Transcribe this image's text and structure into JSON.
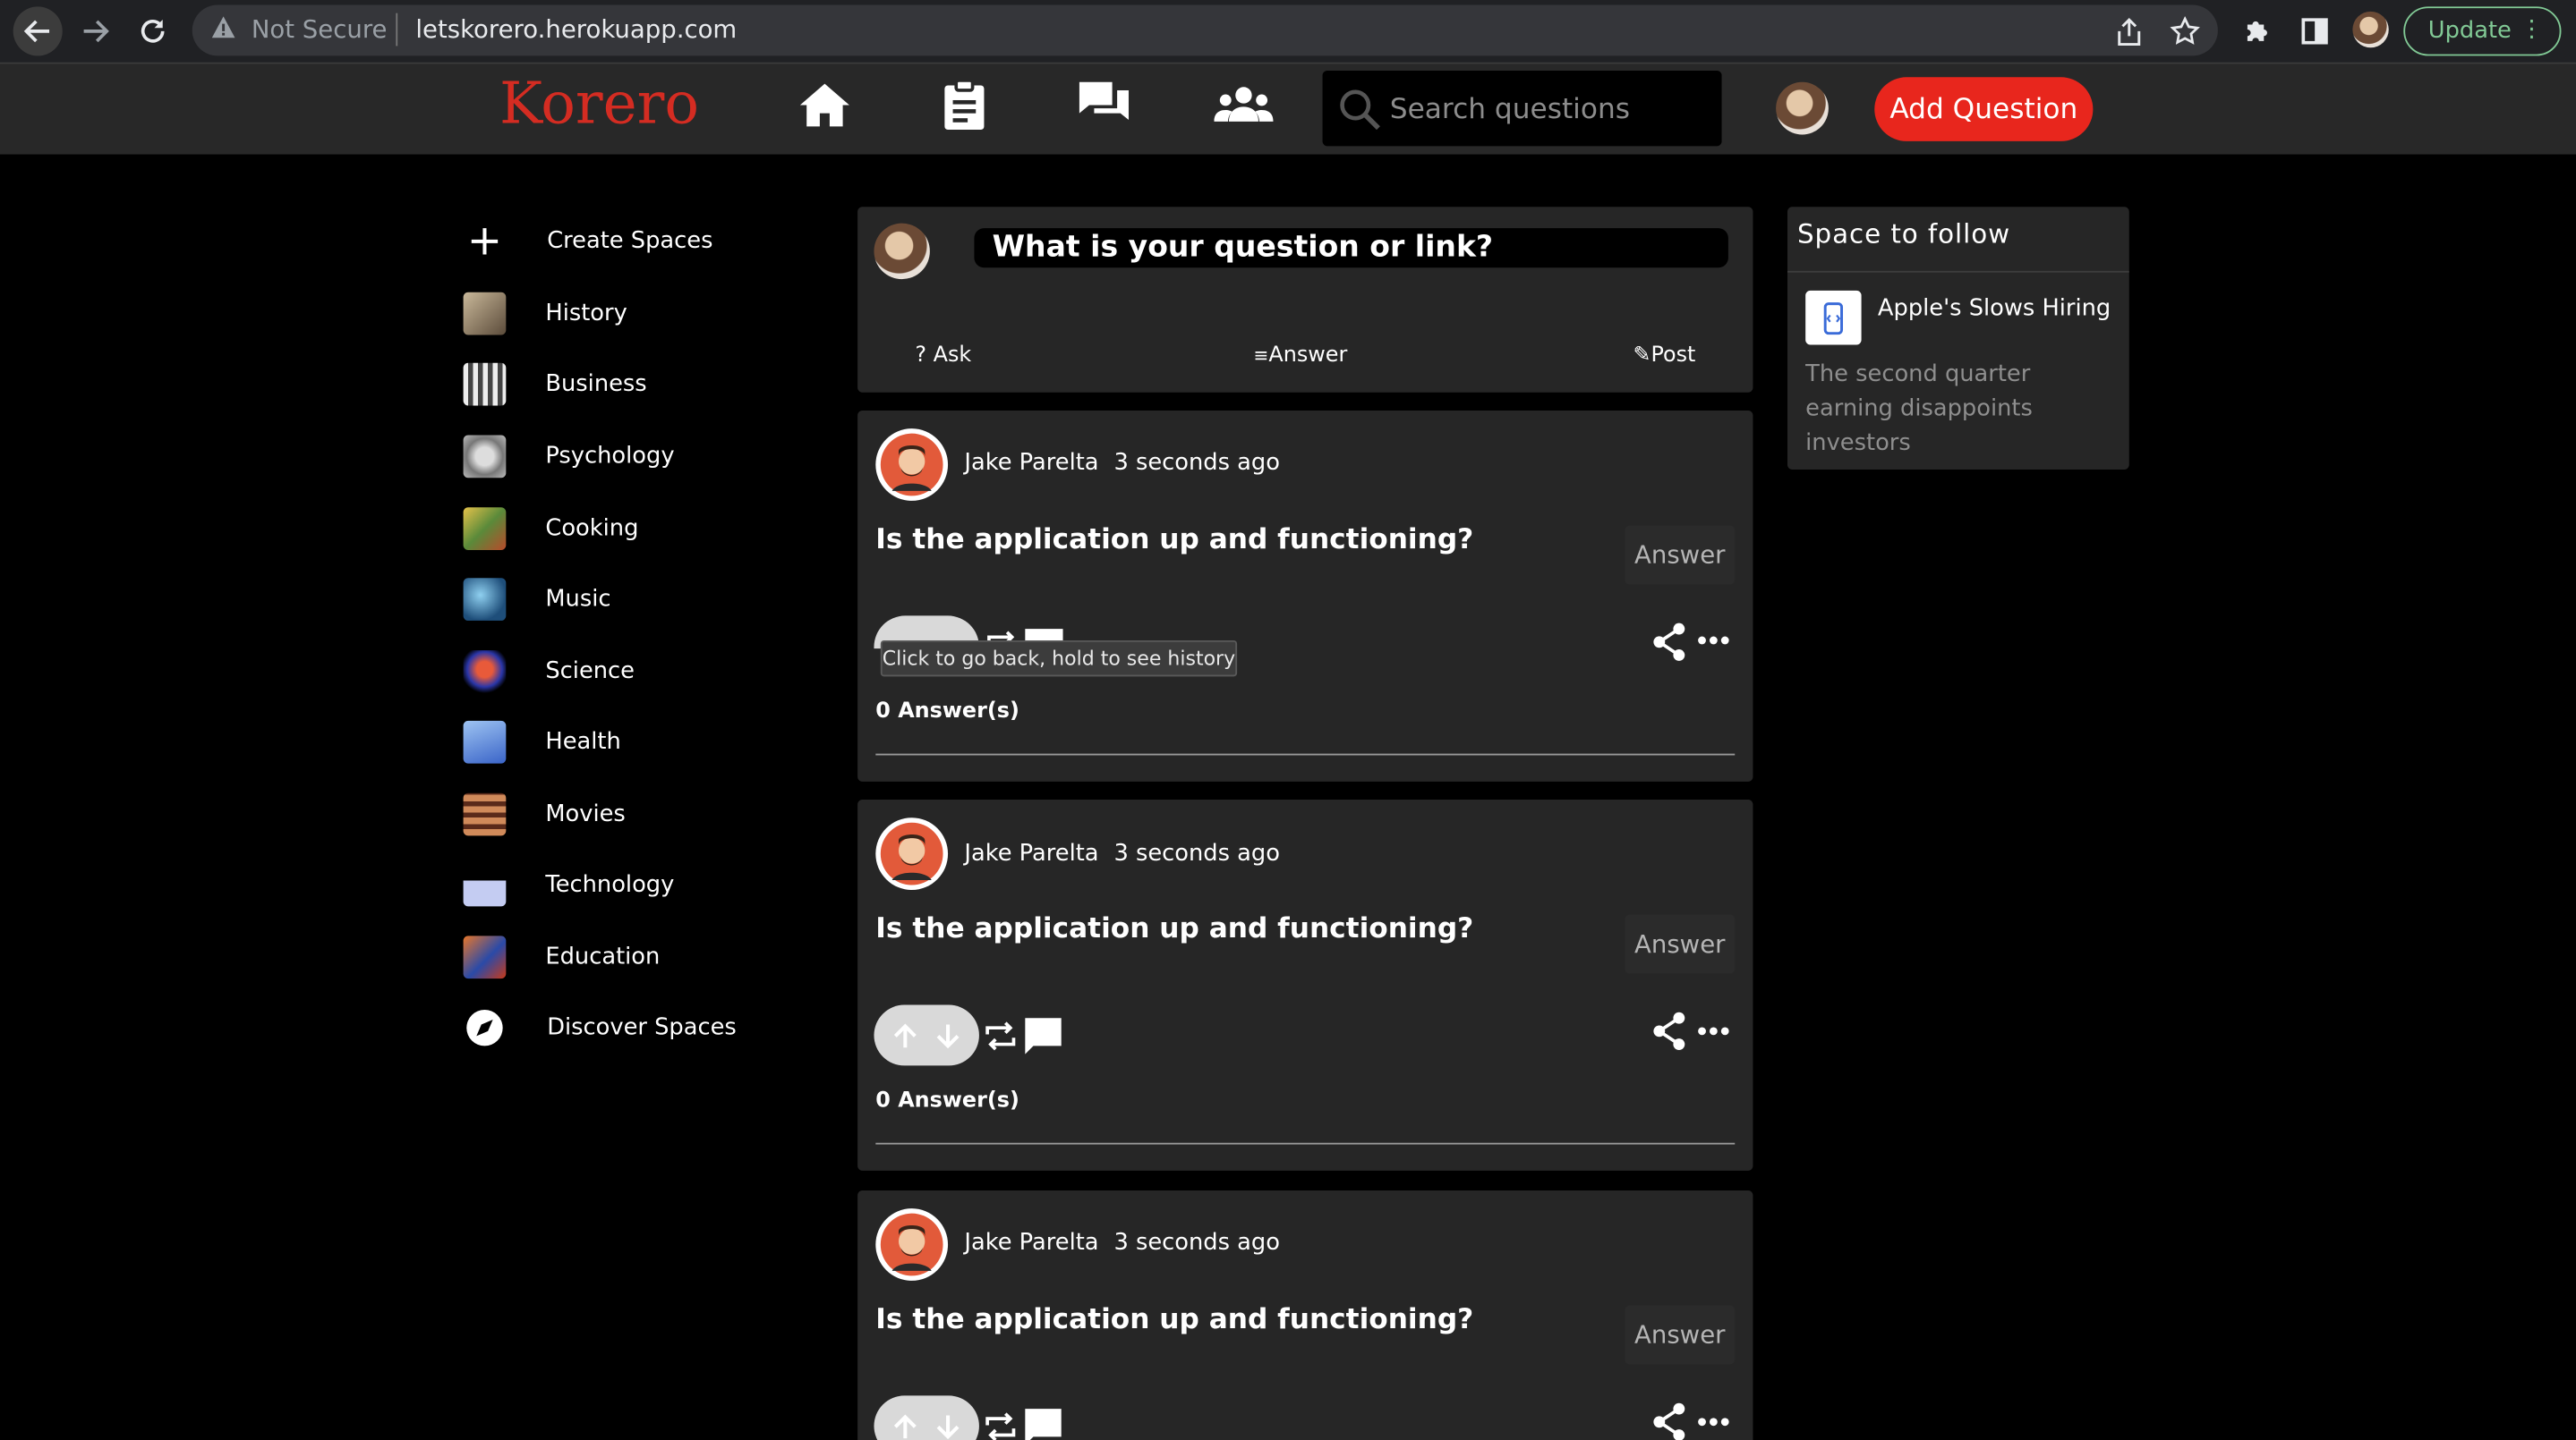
{
  "browser": {
    "security_label": "Not Secure",
    "url": "letskorero.herokuapp.com",
    "update_label": "Update"
  },
  "header": {
    "logo": "Korero",
    "nav_icons": [
      "home-icon",
      "clipboard-icon",
      "chat-icon",
      "people-icon"
    ],
    "search_placeholder": "Search questions",
    "add_question_label": "Add Question"
  },
  "sidebar": {
    "items": [
      {
        "label": "Create Spaces",
        "icon": "plus-icon"
      },
      {
        "label": "History",
        "icon": "history-thumb",
        "color": "#8a7d6a"
      },
      {
        "label": "Business",
        "icon": "business-thumb",
        "color": "#bdbdbd"
      },
      {
        "label": "Psychology",
        "icon": "psychology-thumb",
        "color": "#9a9a9a"
      },
      {
        "label": "Cooking",
        "icon": "cooking-thumb",
        "color": "#c79a3c"
      },
      {
        "label": "Music",
        "icon": "music-thumb",
        "color": "#3d79a8"
      },
      {
        "label": "Science",
        "icon": "science-thumb",
        "color": "#3848b8"
      },
      {
        "label": "Health",
        "icon": "health-thumb",
        "color": "#4f7fd2"
      },
      {
        "label": "Movies",
        "icon": "movies-thumb",
        "color": "#a85c3a"
      },
      {
        "label": "Technology",
        "icon": "technology-thumb",
        "color": "#a9b9e8"
      },
      {
        "label": "Education",
        "icon": "education-thumb",
        "color": "#c85a2a"
      },
      {
        "label": "Discover Spaces",
        "icon": "compass-icon"
      }
    ]
  },
  "ask_box": {
    "prompt": "What is your question or link?",
    "actions": {
      "ask": "Ask",
      "answer": "Answer",
      "post": "Post"
    }
  },
  "posts": [
    {
      "user": "Jake Parelta",
      "time": "3 seconds ago",
      "question": "Is the application up and functioning?",
      "answer_button": "Answer",
      "answer_count": "0 Answer(s)"
    },
    {
      "user": "Jake Parelta",
      "time": "3 seconds ago",
      "question": "Is the application up and functioning?",
      "answer_button": "Answer",
      "answer_count": "0 Answer(s)"
    },
    {
      "user": "Jake Parelta",
      "time": "3 seconds ago",
      "question": "Is the application up and functioning?",
      "answer_button": "Answer",
      "answer_count": ""
    }
  ],
  "tooltip": "Click to go back, hold to see history",
  "spaces_panel": {
    "title": "Space to follow",
    "space_name": "Apple's Slows Hiring",
    "space_description": "The second quarter earning disappoints investors"
  },
  "colors": {
    "accent": "#e8261d",
    "logo": "#d42c22",
    "card": "#262626",
    "header": "#282828",
    "update": "#81c995"
  }
}
